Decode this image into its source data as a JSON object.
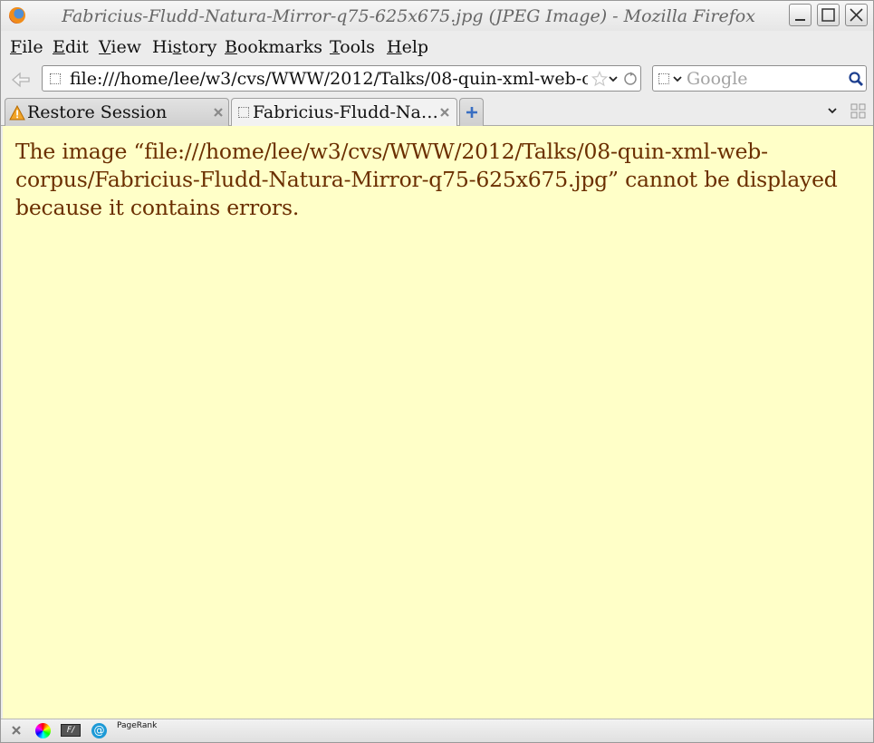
{
  "window": {
    "title": "Fabricius-Fludd-Natura-Mirror-q75-625x675.jpg (JPEG Image) - Mozilla Firefox",
    "controls": [
      "minimize",
      "maximize",
      "close"
    ]
  },
  "menu": {
    "items": [
      {
        "label": "File",
        "underline": "F",
        "rest": "ile"
      },
      {
        "label": "Edit",
        "underline": "E",
        "rest": "dit"
      },
      {
        "label": "View",
        "underline": "V",
        "rest": "iew"
      },
      {
        "label": "History",
        "pre": "Hi",
        "underline": "s",
        "rest": "tory"
      },
      {
        "label": "Bookmarks",
        "underline": "B",
        "rest": "ookmarks"
      },
      {
        "label": "Tools",
        "underline": "T",
        "rest": "ools"
      },
      {
        "label": "Help",
        "underline": "H",
        "rest": "elp"
      }
    ]
  },
  "navbar": {
    "url": "file:///home/lee/w3/cvs/WWW/2012/Talks/08-quin-xml-web-corpus/Fabricius-Fludd-Natura-Mirror-q75-625x675.jpg",
    "search_placeholder": "Google"
  },
  "tabs": [
    {
      "label": "Restore Session",
      "icon": "warning-icon",
      "active": false
    },
    {
      "label": "Fabricius-Fludd-Na…",
      "icon": "page-icon",
      "active": true
    }
  ],
  "content": {
    "message": "The image “file:///home/lee/w3/cvs/WWW/2012/Talks/08-quin-xml-web-corpus/Fabricius-Fludd-Natura-Mirror-q75-625x675.jpg” cannot be displayed because it contains errors.",
    "background_color": "#ffffc8",
    "text_color": "#6b2f00"
  },
  "statusbar": {
    "pagerank_label": "PageRank"
  }
}
